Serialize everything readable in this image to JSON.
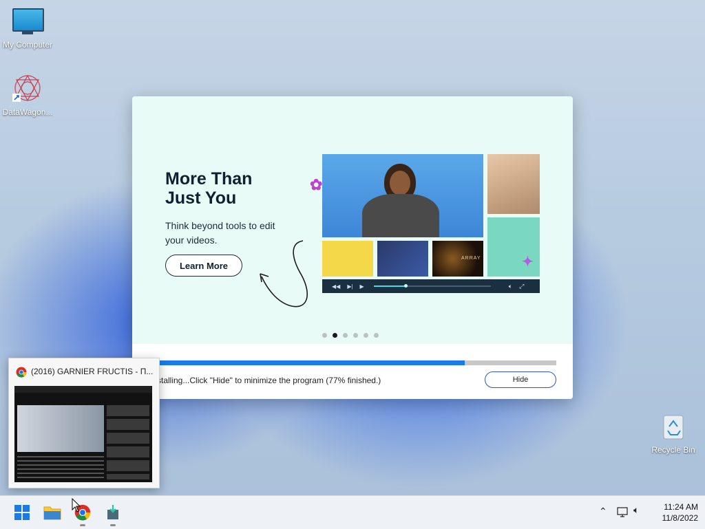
{
  "desktop": {
    "icons": [
      {
        "label": "My Computer"
      },
      {
        "label": "DataWagon..."
      },
      {
        "label": "Recycle Bin"
      }
    ]
  },
  "dialog": {
    "headline_line1": "More Than",
    "headline_line2": "Just You",
    "subtitle": "Think beyond tools to edit your videos.",
    "learn_more_label": "Learn More",
    "thumb_text": "ARRAY",
    "carousel_total": 6,
    "carousel_active": 1,
    "progress_fraction": 0.77,
    "status_text": "stalling...Click \"Hide\" to minimize the program (77% finished.)",
    "hide_label": "Hide"
  },
  "taskbar_preview": {
    "title": "(2016) GARNIER FRUCTIS - П..."
  },
  "taskbar": {
    "time": "11:24 AM",
    "date": "11/8/2022"
  },
  "colors": {
    "accent": "#1a7ae8",
    "dialog_bg": "#e8fbf7"
  }
}
